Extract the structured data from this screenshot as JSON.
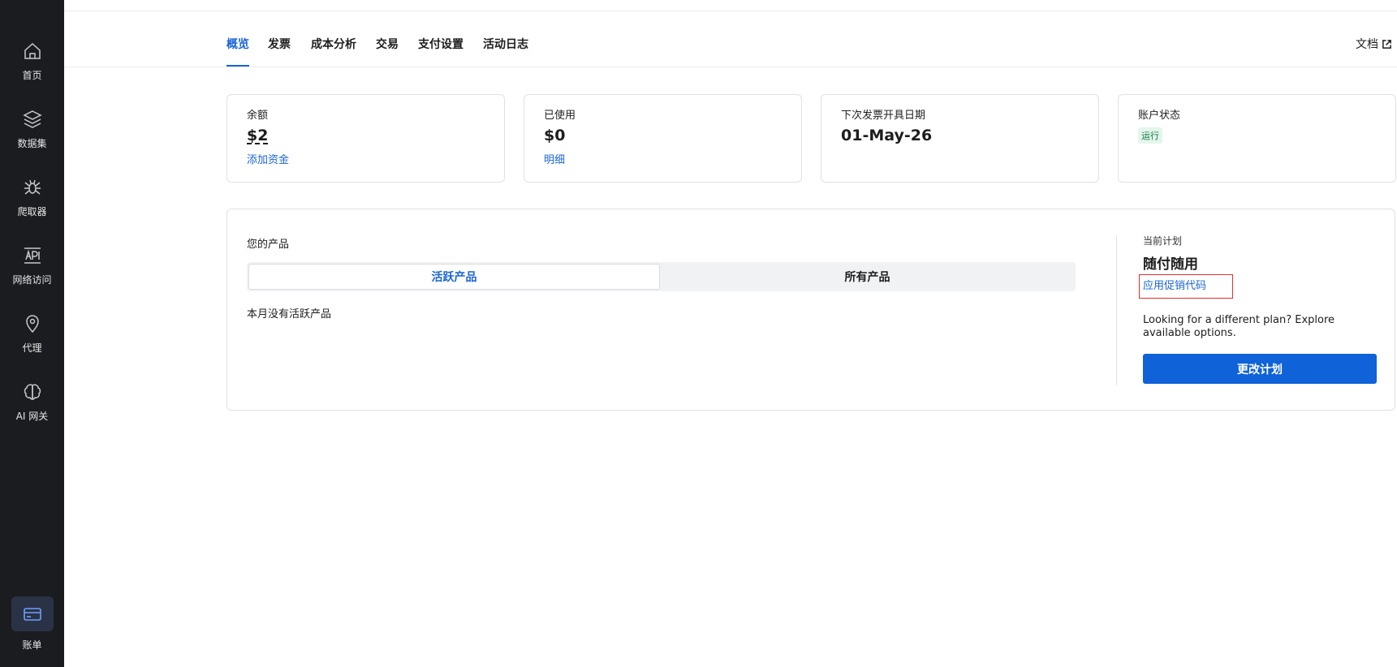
{
  "sidebar": {
    "items": [
      {
        "label": "首页",
        "icon": "home-icon"
      },
      {
        "label": "数据集",
        "icon": "layers-icon"
      },
      {
        "label": "爬取器",
        "icon": "spider-icon"
      },
      {
        "label": "网络访问",
        "icon": "api-icon"
      },
      {
        "label": "代理",
        "icon": "location-pin-icon"
      },
      {
        "label": "AI 网关",
        "icon": "brain-icon"
      }
    ],
    "bottom_item": {
      "label": "账单",
      "icon": "credit-card-icon",
      "active": true
    }
  },
  "tabs": [
    {
      "label": "概览",
      "active": true
    },
    {
      "label": "发票"
    },
    {
      "label": "成本分析"
    },
    {
      "label": "交易"
    },
    {
      "label": "支付设置"
    },
    {
      "label": "活动日志"
    }
  ],
  "docs_label": "文档",
  "cards": {
    "balance": {
      "label": "余额",
      "value": "$2",
      "link": "添加资金"
    },
    "used": {
      "label": "已使用",
      "value": "$0",
      "link": "明细"
    },
    "next_invoice": {
      "label": "下次发票开具日期",
      "value": "01-May-26"
    },
    "account_status": {
      "label": "账户状态",
      "badge": "运行"
    }
  },
  "products": {
    "title": "您的产品",
    "seg_active": "活跃产品",
    "seg_all": "所有产品",
    "empty": "本月没有活跃产品"
  },
  "plan": {
    "label": "当前计划",
    "name": "随付随用",
    "promo_link": "应用促销代码",
    "desc": "Looking for a different plan? Explore available options.",
    "button": "更改计划"
  },
  "colors": {
    "accent": "#1a64d6",
    "sidebar_bg": "#1b1c1f",
    "status_green": "#0f7a45",
    "highlight_red": "#e0312e"
  }
}
